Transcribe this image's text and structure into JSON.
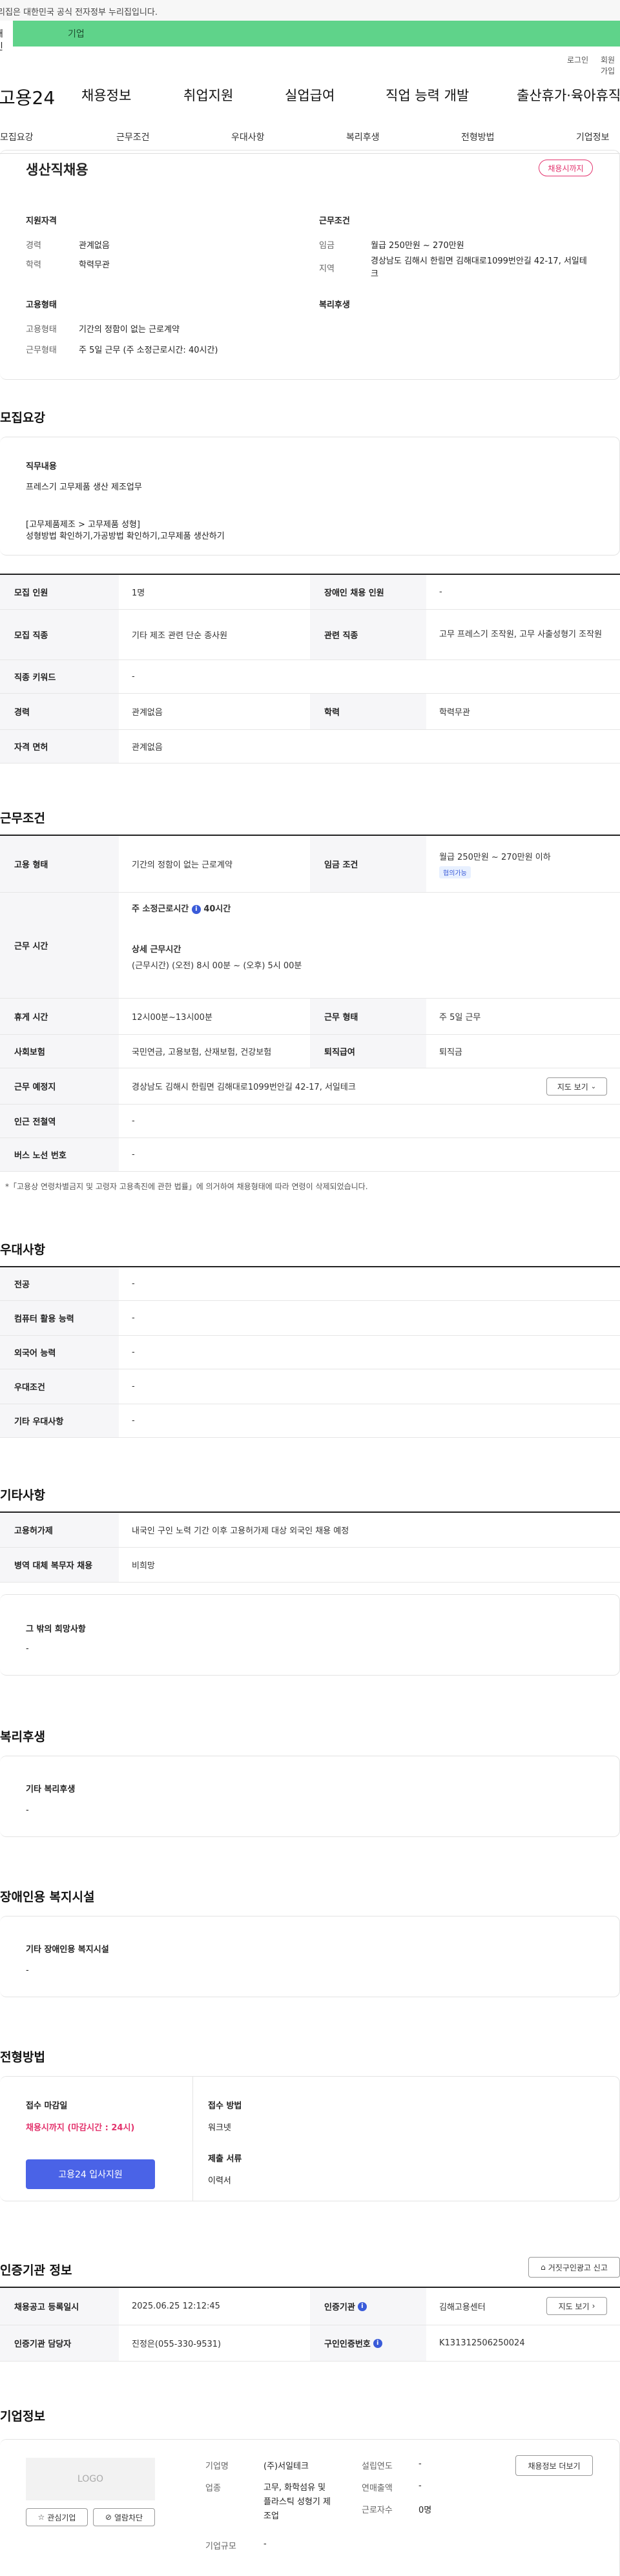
{
  "gov_banner": "이 누리집은 대한민국 공식 전자정부 누리집입니다.",
  "top_tabs": {
    "person": "개인",
    "company": "기업"
  },
  "util": {
    "login": "로그인",
    "join": "회원가입"
  },
  "gnb": {
    "logo": "고용24",
    "menu": [
      "채용정보",
      "취업지원",
      "실업급여",
      "직업 능력 개발",
      "출산휴가·육아휴직"
    ]
  },
  "lnb": [
    "모집요강",
    "근무조건",
    "우대사항",
    "복리후생",
    "전형방법",
    "기업정보"
  ],
  "summary": {
    "title": "생산직채용",
    "badge": "채용시까지",
    "qual_title": "지원자격",
    "career_label": "경력",
    "career_value": "관계없음",
    "edu_label": "학력",
    "edu_value": "학력무관",
    "cond_title": "근무조건",
    "wage_label": "임금",
    "wage_value": "월급 250만원 ~ 270만원",
    "region_label": "지역",
    "region_value": "경상남도 김해시 한림면 김해대로1099번안길 42-17, 서일테크",
    "type_title": "고용형태",
    "emp_label": "고용형태",
    "emp_value": "기간의 정함이 없는 근로계약",
    "worktype_label": "근무형태",
    "worktype_value": "주 5일 근무 (주 소정근로시간: 40시간)",
    "welfare_title": "복리후생"
  },
  "recruit": {
    "section_title": "모집요강",
    "duty_title": "직무내용",
    "duty_value": "프레스기 고무제품 생산 제조업무",
    "duty_cat": "[고무제품제조 > 고무제품 성형]",
    "duty_desc": "성형방법 확인하기,가공방법 확인하기,고무제품 생산하기",
    "rows": [
      {
        "h1": "모집 인원",
        "v1": "1명",
        "h2": "장애인 채용 인원",
        "v2": "-"
      },
      {
        "h1": "모집 직종",
        "v1": "기타 제조 관련 단순 종사원",
        "h2": "관련 직종",
        "v2": "고무 프레스기 조작원, 고무 사출성형기 조작원"
      },
      {
        "h1": "직종 키워드",
        "v1": "-"
      },
      {
        "h1": "경력",
        "v1": "관계없음",
        "h2": "학력",
        "v2": "학력무관"
      },
      {
        "h1": "자격 면허",
        "v1": "관계없음"
      }
    ]
  },
  "conditions": {
    "section_title": "근무조건",
    "emp_h": "고용 형태",
    "emp_v": "기간의 정함이 없는 근로계약",
    "wage_h": "임금 조건",
    "wage_v": "월급 250만원 ~ 270만원 이하",
    "wage_tag": "협의가능",
    "time_h": "근무 시간",
    "time_l1": "주 소정근로시간",
    "time_l1_val": "40시간",
    "time_l2": "상세 근무시간",
    "time_l3": "(근무시간) (오전) 8시 00분 ~ (오후) 5시 00분",
    "break_h": "휴게 시간",
    "break_v": "12시00분~13시00분",
    "form_h": "근무 형태",
    "form_v": "주 5일 근무",
    "ins_h": "사회보험",
    "ins_v": "국민연금, 고용보험, 산재보험, 건강보험",
    "ret_h": "퇴직급여",
    "ret_v": "퇴직금",
    "loc_h": "근무 예정지",
    "loc_v": "경상남도 김해시 한림면 김해대로1099번안길 42-17, 서일테크",
    "map_btn": "지도 보기",
    "sub_h": "인근 전철역",
    "sub_v": "-",
    "bus_h": "버스 노선 번호",
    "bus_v": "-",
    "note": "*「고용상 연령차별금지 및 고령자 고용촉진에 관한 법률」에 의거하여 채용형태에 따라 연령이 삭제되었습니다."
  },
  "pref": {
    "section_title": "우대사항",
    "rows": [
      {
        "h": "전공",
        "v": "-"
      },
      {
        "h": "컴퓨터 활용 능력",
        "v": "-"
      },
      {
        "h": "외국어 능력",
        "v": "-"
      },
      {
        "h": "우대조건",
        "v": "-"
      },
      {
        "h": "기타 우대사항",
        "v": "-"
      }
    ]
  },
  "etc": {
    "section_title": "기타사항",
    "rows": [
      {
        "h": "고용허가제",
        "v": "내국인 구인 노력 기간 이후 고용허가제 대상 외국인 채용 예정"
      },
      {
        "h": "병역 대체 복무자 채용",
        "v": "비희망"
      }
    ],
    "other_title": "그 밖의 희망사항",
    "other_value": "-"
  },
  "welfare": {
    "section_title": "복리후생",
    "box_title": "기타 복리후생",
    "box_value": "-"
  },
  "disabled": {
    "section_title": "장애인용 복지시설",
    "box_title": "기타 장애인용 복지시설",
    "box_value": "-"
  },
  "selection": {
    "section_title": "전형방법",
    "deadline_title": "접수 마감일",
    "deadline_value": "채용시까지 (마감시간 : 24시)",
    "apply_btn": "고용24 입사지원",
    "method_title": "접수 방법",
    "method_value": "워크넷",
    "docs_title": "제출 서류",
    "docs_value": "이력서"
  },
  "agency": {
    "section_title": "인증기관 정보",
    "report_btn": "거짓구인광고 신고",
    "reg_h": "채용공고 등록일시",
    "reg_v": "2025.06.25 12:12:45",
    "org_h": "인증기관",
    "org_v": "김해고용센터",
    "map_btn": "지도 보기",
    "mgr_h": "인증기관 담당자",
    "mgr_v": "진정은(055-330-9531)",
    "num_h": "구인인증번호",
    "num_v": "K131312506250024"
  },
  "company": {
    "section_title": "기업정보",
    "logo": "LOGO",
    "fav_btn": "관심기업",
    "block_btn": "열람차단",
    "name_l": "기업명",
    "name_v": "(주)서일테크",
    "ind_l": "업종",
    "ind_v": "고무, 화학섬유 및 플라스틱 성형기 제조업",
    "size_l": "기업규모",
    "size_v": "-",
    "est_l": "설립연도",
    "est_v": "-",
    "sales_l": "연매출액",
    "sales_v": "-",
    "emp_l": "근로자수",
    "emp_v": "0명",
    "recruit_btn": "채용정보 더보기"
  }
}
